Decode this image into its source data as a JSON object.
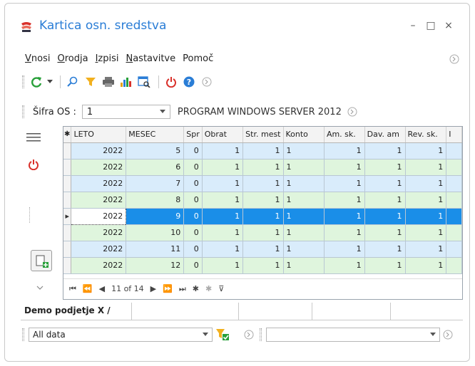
{
  "window": {
    "title": "Kartica osn. sredstva",
    "minimize_glyph": "–",
    "maximize_glyph": "□",
    "close_glyph": "×"
  },
  "menu": {
    "items": [
      {
        "label": "Vnosi",
        "ul": "V",
        "rest": "nosi"
      },
      {
        "label": "Orodja",
        "ul": "O",
        "rest": "rodja"
      },
      {
        "label": "Izpisi",
        "ul": "I",
        "rest": "zpisi"
      },
      {
        "label": "Nastavitve",
        "ul": "N",
        "rest": "astavitve"
      },
      {
        "label": "Pomoč",
        "ul": "",
        "rest": "Pomoč"
      }
    ]
  },
  "toolbar": {
    "icons": [
      "refresh-icon",
      "dropdown-arrow-icon",
      "search-icon",
      "filter-icon",
      "print-icon",
      "chart-icon",
      "report-icon",
      "power-icon",
      "help-icon",
      "collapse-icon"
    ]
  },
  "asset": {
    "label": "Šifra OS :",
    "value": "1",
    "name": "PROGRAM WINDOWS SERVER 2012"
  },
  "grid": {
    "columns": [
      "LETO",
      "MESEC",
      "Spr",
      "Obrat",
      "Str. mest",
      "Konto",
      "Am. sk.",
      "Dav. am",
      "Rev. sk.",
      "I"
    ],
    "rows": [
      {
        "leto": "2022",
        "mesec": "5",
        "spr": "0",
        "obrat": "1",
        "str": "1",
        "konto": "1",
        "am": "1",
        "dav": "1",
        "rev": "1",
        "style": "blue"
      },
      {
        "leto": "2022",
        "mesec": "6",
        "spr": "0",
        "obrat": "1",
        "str": "1",
        "konto": "1",
        "am": "1",
        "dav": "1",
        "rev": "1",
        "style": "green"
      },
      {
        "leto": "2022",
        "mesec": "7",
        "spr": "0",
        "obrat": "1",
        "str": "1",
        "konto": "1",
        "am": "1",
        "dav": "1",
        "rev": "1",
        "style": "blue"
      },
      {
        "leto": "2022",
        "mesec": "8",
        "spr": "0",
        "obrat": "1",
        "str": "1",
        "konto": "1",
        "am": "1",
        "dav": "1",
        "rev": "1",
        "style": "green"
      },
      {
        "leto": "2022",
        "mesec": "9",
        "spr": "0",
        "obrat": "1",
        "str": "1",
        "konto": "1",
        "am": "1",
        "dav": "1",
        "rev": "1",
        "style": "sel"
      },
      {
        "leto": "2022",
        "mesec": "10",
        "spr": "0",
        "obrat": "1",
        "str": "1",
        "konto": "1",
        "am": "1",
        "dav": "1",
        "rev": "1",
        "style": "green"
      },
      {
        "leto": "2022",
        "mesec": "11",
        "spr": "0",
        "obrat": "1",
        "str": "1",
        "konto": "1",
        "am": "1",
        "dav": "1",
        "rev": "1",
        "style": "blue"
      },
      {
        "leto": "2022",
        "mesec": "12",
        "spr": "0",
        "obrat": "1",
        "str": "1",
        "konto": "1",
        "am": "1",
        "dav": "1",
        "rev": "1",
        "style": "green"
      }
    ],
    "nav_record": "11 of 14"
  },
  "tab": {
    "label": "Demo podjetje X /"
  },
  "filter": {
    "value": "All data",
    "second_value": ""
  },
  "colors": {
    "accent": "#2a7dd6",
    "selected_row": "#1a8ee8",
    "row_blue": "#d9ecfb",
    "row_green": "#dff5dd",
    "power": "#d9302a"
  }
}
